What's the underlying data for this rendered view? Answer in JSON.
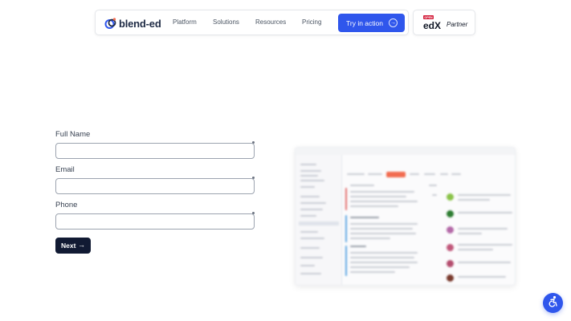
{
  "header": {
    "logo_text": "blend-ed",
    "nav": {
      "platform": "Platform",
      "solutions": "Solutions",
      "resources": "Resources",
      "pricing": "Pricing"
    },
    "cta_label": "Try in action",
    "partner": {
      "logo_text": "edX",
      "logo_badge": "OPEN",
      "label": "Partner"
    }
  },
  "form": {
    "full_name": {
      "label": "Full Name",
      "value": "",
      "placeholder": ""
    },
    "email": {
      "label": "Email",
      "value": "",
      "placeholder": ""
    },
    "phone": {
      "label": "Phone",
      "value": "",
      "placeholder": ""
    },
    "next_label": "Next"
  },
  "icons": {
    "cta_arrow": "arrow-right-circle-icon",
    "next_arrow": "arrow-right-icon",
    "widget": "accessibility-icon"
  },
  "colors": {
    "brand_blue": "#2f56ec",
    "next_button": "#111a33",
    "preview_accent": "#f26b4f"
  }
}
